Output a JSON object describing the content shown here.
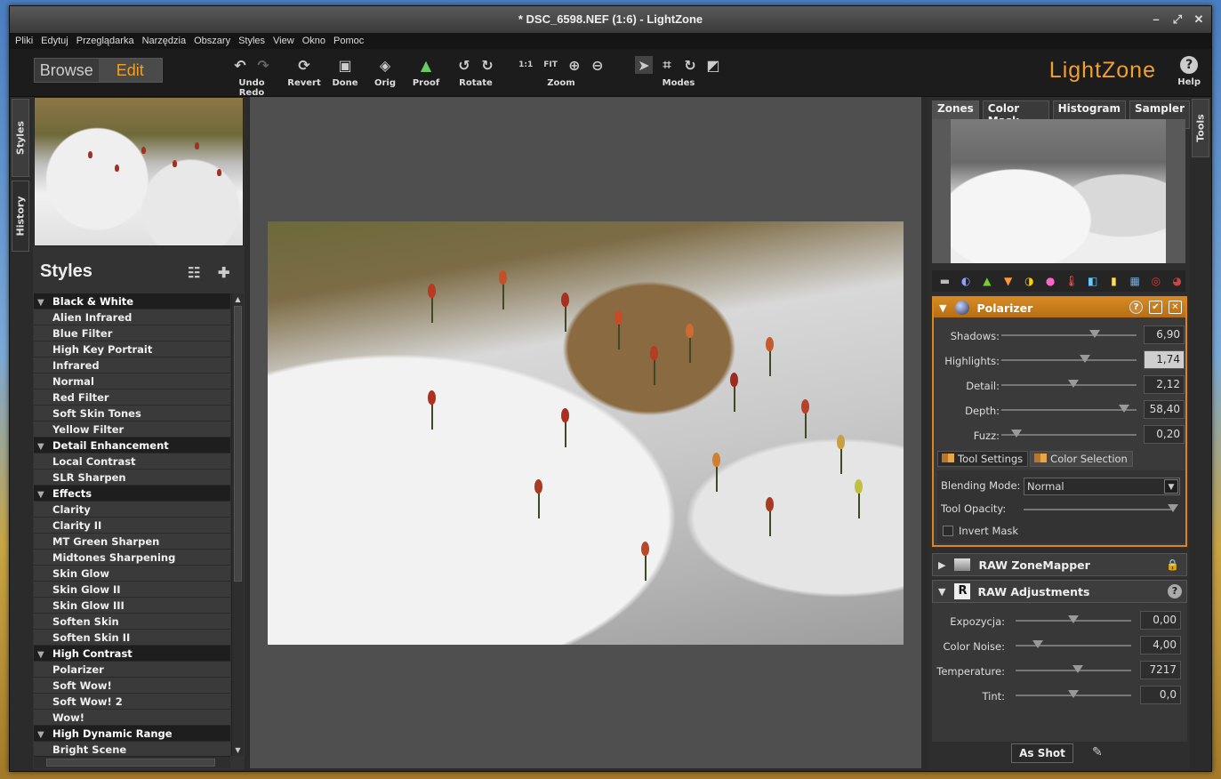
{
  "window": {
    "title": "* DSC_6598.NEF (1:6) - LightZone",
    "minimize": "–",
    "maximize": "⤢",
    "close": "✕"
  },
  "menu": [
    "Pliki",
    "Edytuj",
    "Przeglądarka",
    "Narzędzia",
    "Obszary",
    "Styles",
    "View",
    "Okno",
    "Pomoc"
  ],
  "mode": {
    "browse": "Browse",
    "edit": "Edit"
  },
  "toolbar": {
    "undo_redo": "Undo Redo",
    "revert": "Revert",
    "done": "Done",
    "orig": "Orig",
    "proof": "Proof",
    "rotate": "Rotate",
    "zoom": "Zoom",
    "zoom_1to1": "1:1",
    "zoom_fit": "FIT",
    "modes": "Modes",
    "help": "Help"
  },
  "logo": "LightZone",
  "left_tabs": {
    "styles": "Styles",
    "history": "History"
  },
  "styles_panel": {
    "title": "Styles",
    "rows": [
      {
        "label": "Black & White",
        "group": true
      },
      {
        "label": "Alien Infrared",
        "group": false
      },
      {
        "label": "Blue Filter",
        "group": false
      },
      {
        "label": "High Key Portrait",
        "group": false
      },
      {
        "label": "Infrared",
        "group": false
      },
      {
        "label": "Normal",
        "group": false
      },
      {
        "label": "Red Filter",
        "group": false
      },
      {
        "label": "Soft Skin Tones",
        "group": false
      },
      {
        "label": "Yellow Filter",
        "group": false
      },
      {
        "label": "Detail Enhancement",
        "group": true
      },
      {
        "label": "Local Contrast",
        "group": false
      },
      {
        "label": "SLR Sharpen",
        "group": false
      },
      {
        "label": "Effects",
        "group": true
      },
      {
        "label": "Clarity",
        "group": false
      },
      {
        "label": "Clarity II",
        "group": false
      },
      {
        "label": "MT Green Sharpen",
        "group": false
      },
      {
        "label": "Midtones Sharpening",
        "group": false
      },
      {
        "label": "Skin Glow",
        "group": false
      },
      {
        "label": "Skin Glow II",
        "group": false
      },
      {
        "label": "Skin Glow III",
        "group": false
      },
      {
        "label": "Soften Skin",
        "group": false
      },
      {
        "label": "Soften Skin II",
        "group": false
      },
      {
        "label": "High Contrast",
        "group": true
      },
      {
        "label": "Polarizer",
        "group": false
      },
      {
        "label": "Soft Wow!",
        "group": false
      },
      {
        "label": "Soft Wow! 2",
        "group": false
      },
      {
        "label": "Wow!",
        "group": false
      },
      {
        "label": "High Dynamic Range",
        "group": true
      },
      {
        "label": "Bright Scene",
        "group": false
      }
    ]
  },
  "right_tabs": [
    "Zones",
    "Color Mask",
    "Histogram",
    "Sampler"
  ],
  "tools_tab": "Tools",
  "polarizer": {
    "title": "Polarizer",
    "sliders": [
      {
        "label": "Shadows:",
        "value": "6,90",
        "pos": 0.69
      },
      {
        "label": "Highlights:",
        "value": "1,74",
        "pos": 0.62,
        "selected": true
      },
      {
        "label": "Detail:",
        "value": "2,12",
        "pos": 0.53
      },
      {
        "label": "Depth:",
        "value": "58,40",
        "pos": 0.91
      },
      {
        "label": "Fuzz:",
        "value": "0,20",
        "pos": 0.11
      }
    ],
    "tab_tool_settings": "Tool Settings",
    "tab_color_selection": "Color Selection",
    "blending_mode_label": "Blending Mode:",
    "blending_mode_value": "Normal",
    "tool_opacity_label": "Tool Opacity:",
    "tool_opacity_value": 1.0,
    "invert_mask_label": "Invert Mask"
  },
  "zone_mapper": {
    "title": "RAW ZoneMapper"
  },
  "raw_adjustments": {
    "title": "RAW Adjustments",
    "sliders": [
      {
        "label": "Expozycja:",
        "value": "0,00",
        "pos": 0.5
      },
      {
        "label": "Color Noise:",
        "value": "4,00",
        "pos": 0.19
      },
      {
        "label": "Temperature:",
        "value": "7217",
        "pos": 0.54
      },
      {
        "label": "Tint:",
        "value": "0,0",
        "pos": 0.5
      }
    ],
    "as_shot": "As Shot"
  },
  "colors": {
    "accent": "#f3a020",
    "panel": "#2b2b2b",
    "tool_header": "#d58a24"
  }
}
